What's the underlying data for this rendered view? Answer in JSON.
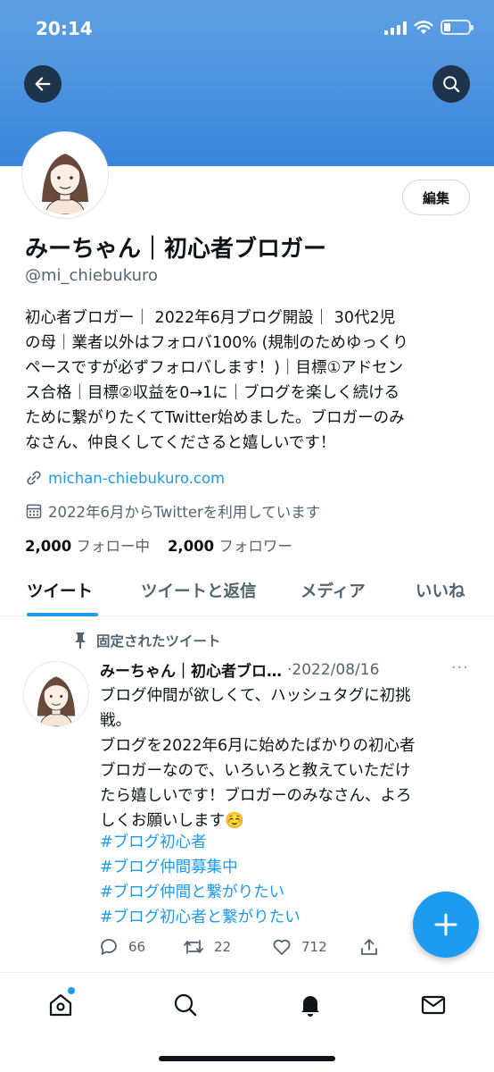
{
  "status_bar": {
    "time": "20:14"
  },
  "header": {
    "back_icon": "arrow-left-icon",
    "search_icon": "search-icon"
  },
  "profile": {
    "edit_label": "編集",
    "display_name": "みーちゃん｜初心者ブロガー",
    "handle": "@mi_chiebukuro",
    "bio": "初心者ブロガー｜ 2022年6月ブログ開設｜ 30代2児\nの母｜業者以外はフォロバ100% (規制のためゆっくり\nペースですが必ずフォロバします！)｜目標①アドセン\nス合格｜目標②収益を0→1に｜ブログを楽しく続ける\nために繋がりたくてTwitter始めました。ブロガーのみ\nなさん、仲良くしてくださると嬉しいです！",
    "link": "michan-chiebukuro.com",
    "joined": "2022年6月からTwitterを利用しています",
    "following_count": "2,000",
    "following_label": "フォロー中",
    "followers_count": "2,000",
    "followers_label": "フォロワー"
  },
  "tabs": [
    {
      "label": "ツイート",
      "active": true
    },
    {
      "label": "ツイートと返信",
      "active": false
    },
    {
      "label": "メディア",
      "active": false
    },
    {
      "label": "いいね",
      "active": false
    }
  ],
  "pinned_tweet": {
    "pinned_label": "固定されたツイート",
    "author": "みーちゃん｜初心者ブロ…",
    "date": "·2022/08/16",
    "more": "···",
    "text": "ブログ仲間が欲しくて、ハッシュタグに初挑\n戦。\nブログを2022年6月に始めたばかりの初心者\nブロガーなので、いろいろと教えていただけ\nたら嬉しいです！ブロガーのみなさん、よろ\nしくお願いします☺️",
    "hashtags": [
      "#ブログ初心者",
      "#ブログ仲間募集中",
      "#ブログ仲間と繋がりたい",
      "#ブログ初心者と繋がりたい"
    ],
    "replies": "66",
    "retweets": "22",
    "likes": "712"
  },
  "colors": {
    "accent": "#1d9bf0",
    "banner": "#4a90e2",
    "text": "#0f1419",
    "muted": "#536471"
  },
  "nav": {
    "icons": [
      "home-icon",
      "search-icon",
      "bell-icon",
      "mail-icon"
    ]
  }
}
